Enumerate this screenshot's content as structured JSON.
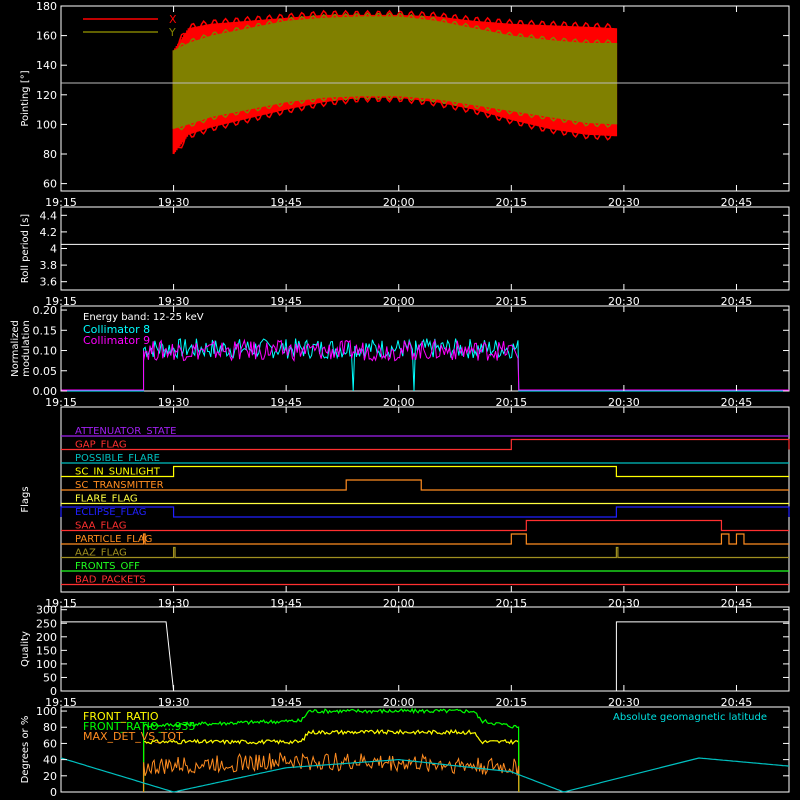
{
  "chart_data": [
    {
      "id": "pointing",
      "type": "area",
      "ylabel": "Pointing [°]",
      "ylim": [
        55,
        180
      ],
      "yticks": [
        60,
        80,
        100,
        120,
        140,
        160,
        180
      ],
      "x_range": [
        "19:15",
        "20:52"
      ],
      "x_ticks": [
        "19:15",
        "19:30",
        "19:45",
        "20:00",
        "20:15",
        "20:30",
        "20:45"
      ],
      "reference_line": 128,
      "legend_position": "top-left",
      "series": [
        {
          "name": "X",
          "color": "#ff0000",
          "x": [
            "19:30",
            "19:32",
            "19:35",
            "19:40",
            "19:45",
            "19:50",
            "19:55",
            "20:00",
            "20:05",
            "20:10",
            "20:15",
            "20:20",
            "20:25",
            "20:29"
          ],
          "y_low": [
            80,
            93,
            98,
            104,
            110,
            115,
            118,
            118,
            115,
            110,
            103,
            97,
            93,
            92
          ],
          "y_high": [
            150,
            165,
            168,
            170,
            172,
            174,
            174,
            174,
            173,
            170,
            168,
            167,
            166,
            165
          ]
        },
        {
          "name": "Y",
          "color": "#808000",
          "x": [
            "19:30",
            "19:32",
            "19:35",
            "19:40",
            "19:45",
            "19:50",
            "19:55",
            "20:00",
            "20:05",
            "20:10",
            "20:15",
            "20:20",
            "20:25",
            "20:29"
          ],
          "y_low": [
            97,
            100,
            105,
            110,
            115,
            118,
            119,
            119,
            117,
            113,
            109,
            105,
            101,
            100
          ],
          "y_high": [
            150,
            155,
            160,
            165,
            170,
            172,
            173,
            173,
            170,
            165,
            160,
            157,
            155,
            155
          ]
        }
      ]
    },
    {
      "id": "roll",
      "type": "line",
      "ylabel": "Roll period [s]",
      "ylim": [
        3.5,
        4.5
      ],
      "yticks": [
        3.6,
        3.8,
        4.0,
        4.2,
        4.4
      ],
      "x_range": [
        "19:15",
        "20:52"
      ],
      "x_ticks": [
        "19:15",
        "19:30",
        "19:45",
        "20:00",
        "20:15",
        "20:30",
        "20:45"
      ],
      "series": [
        {
          "color": "#ffffff",
          "x": [
            "19:15",
            "20:52"
          ],
          "values": [
            4.05,
            4.05
          ]
        }
      ]
    },
    {
      "id": "modulation",
      "type": "line",
      "ylabel": [
        "Normalized",
        "modulation"
      ],
      "ylim": [
        0,
        0.21
      ],
      "yticks": [
        0.0,
        0.05,
        0.1,
        0.15,
        0.2
      ],
      "tick_format": 2,
      "x_range": [
        "19:15",
        "20:52"
      ],
      "x_ticks": [
        "19:15",
        "19:30",
        "19:45",
        "20:00",
        "20:15",
        "20:30",
        "20:45"
      ],
      "annotation": "Energy band: 12-25 keV",
      "legend_position": "top-left",
      "active_start": "19:26",
      "active_end": "20:16",
      "series": [
        {
          "name": "Collimator 8",
          "color": "#00ffff",
          "level": 0.105,
          "dips": [
            "19:54",
            "20:02"
          ]
        },
        {
          "name": "Collimator 9",
          "color": "#ff00ff",
          "level": 0.1,
          "dips": []
        }
      ]
    },
    {
      "id": "flags",
      "type": "line",
      "ylabel": "Flags",
      "x_range": [
        "19:15",
        "20:52"
      ],
      "x_ticks": [
        "19:15",
        "19:30",
        "19:45",
        "20:00",
        "20:15",
        "20:30",
        "20:45"
      ],
      "series": [
        {
          "name": "ATTENUATOR_STATE",
          "color": "#a020f0",
          "steps": []
        },
        {
          "name": "GAP_FLAG",
          "color": "#ff3030",
          "steps": [
            [
              "20:15",
              "20:52"
            ]
          ]
        },
        {
          "name": "POSSIBLE_FLARE",
          "color": "#00c0c0",
          "steps": []
        },
        {
          "name": "SC_IN_SUNLIGHT",
          "color": "#ffff00",
          "steps": [
            [
              "19:30",
              "20:29"
            ]
          ]
        },
        {
          "name": "SC_TRANSMITTER",
          "color": "#ff8c20",
          "steps": [
            [
              "19:53",
              "20:03"
            ]
          ]
        },
        {
          "name": "FLARE_FLAG",
          "color": "#ffff40",
          "steps": []
        },
        {
          "name": "ECLIPSE_FLAG",
          "color": "#2020ff",
          "steps": [
            [
              "19:15",
              "19:30"
            ],
            [
              "20:29",
              "20:52"
            ]
          ]
        },
        {
          "name": "SAA_FLAG",
          "color": "#ff3030",
          "steps": [
            [
              "20:17",
              "20:43"
            ]
          ]
        },
        {
          "name": "PARTICLE_FLAG",
          "color": "#ff8c20",
          "steps": [
            [
              "19:26",
              "19:26"
            ],
            [
              "20:15",
              "20:17"
            ],
            [
              "20:43",
              "20:44"
            ],
            [
              "20:45",
              "20:46"
            ]
          ]
        },
        {
          "name": "AAZ_FLAG",
          "color": "#a09020",
          "steps": [
            [
              "19:30",
              "19:30"
            ],
            [
              "20:29",
              "20:29"
            ]
          ]
        },
        {
          "name": "FRONTS_OFF",
          "color": "#20ff20",
          "steps": []
        },
        {
          "name": "BAD_PACKETS",
          "color": "#ff3030",
          "steps": []
        }
      ]
    },
    {
      "id": "quality",
      "type": "line",
      "ylabel": "Quality",
      "ylim": [
        0,
        310
      ],
      "yticks": [
        0,
        50,
        100,
        150,
        200,
        250,
        300
      ],
      "x_range": [
        "19:15",
        "20:52"
      ],
      "x_ticks": [
        "19:15",
        "19:30",
        "19:45",
        "20:00",
        "20:15",
        "20:30",
        "20:45"
      ],
      "series": [
        {
          "color": "#ffffff",
          "x": [
            "19:15",
            "19:29",
            "19:30",
            "20:29",
            "20:29",
            "20:52"
          ],
          "values": [
            255,
            255,
            0,
            0,
            255,
            255
          ]
        }
      ]
    },
    {
      "id": "ratios",
      "type": "line",
      "ylabel": "Degrees or %",
      "ylim": [
        0,
        105
      ],
      "yticks": [
        0,
        20,
        40,
        60,
        80,
        100
      ],
      "x_range": [
        "19:15",
        "20:52"
      ],
      "legend_position": "top-left",
      "right_label": "Absolute geomagnetic latitude",
      "right_label_color": "#00e0e0",
      "series": [
        {
          "name": "FRONT_RATIO",
          "color": "#ffff00",
          "x": [
            "19:26",
            "19:47",
            "19:48",
            "20:10",
            "20:11",
            "20:16"
          ],
          "values": [
            62,
            62,
            74,
            74,
            62,
            62
          ]
        },
        {
          "name": "FRONT_RATIO_...935",
          "color": "#00ff00",
          "x": [
            "19:26",
            "19:47",
            "19:48",
            "20:10",
            "20:11",
            "20:16"
          ],
          "values": [
            82,
            88,
            100,
            100,
            88,
            80
          ]
        },
        {
          "name": "MAX_DET_VS_TOT",
          "color": "#ff8c20",
          "x": [
            "19:26",
            "19:35",
            "19:45",
            "19:55",
            "20:05",
            "20:16"
          ],
          "values": [
            30,
            35,
            38,
            37,
            35,
            30
          ]
        },
        {
          "name": "Absolute geomagnetic latitude",
          "color": "#00c0c0",
          "x": [
            "19:15",
            "19:30",
            "19:45",
            "20:00",
            "20:15",
            "20:22",
            "20:40",
            "20:52"
          ],
          "values": [
            42,
            0,
            30,
            40,
            25,
            0,
            42,
            32
          ]
        }
      ]
    }
  ]
}
